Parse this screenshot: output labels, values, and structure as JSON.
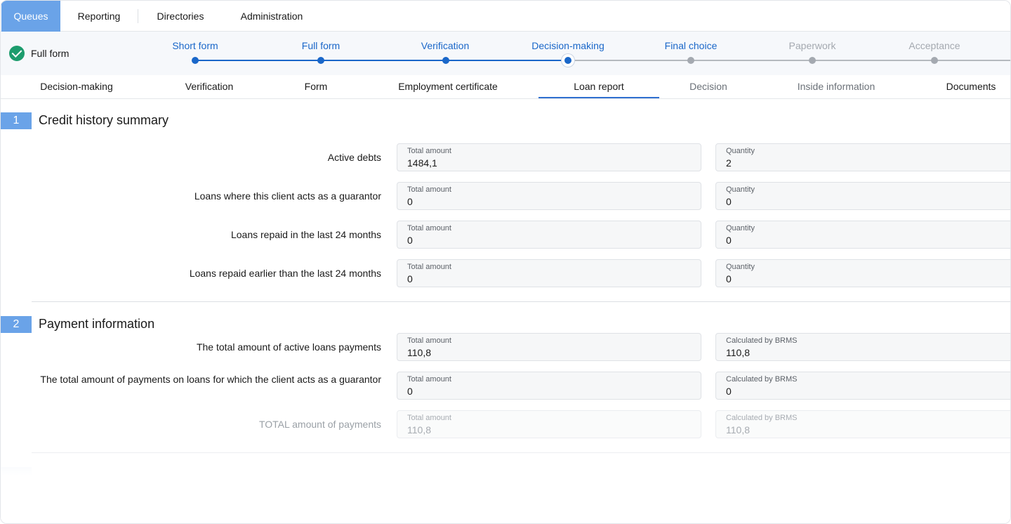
{
  "topnav": {
    "items": [
      "Queues",
      "Reporting",
      "Directories",
      "Administration"
    ],
    "active_color": "#6aa3e8"
  },
  "form_status": {
    "label": "Full form",
    "icon": "check-circle-icon",
    "color": "#1c9c6d"
  },
  "stepper": {
    "steps": [
      "Short form",
      "Full form",
      "Verification",
      "Decision-making",
      "Final choice",
      "Paperwork",
      "Acceptance"
    ],
    "current": "Decision-making",
    "done_color": "#1a67c9",
    "todo_color": "#a4a9b0"
  },
  "subtabs": {
    "items": [
      "Decision-making",
      "Verification",
      "Form",
      "Employment certificate",
      "Loan report",
      "Decision",
      "Inside information",
      "Documents"
    ],
    "active": "Loan report",
    "accent": "#2f6fcf"
  },
  "sections": [
    {
      "number": "1",
      "title": "Credit history summary",
      "rows": [
        {
          "label": "Active debts",
          "f1_caption": "Total amount",
          "f1_value": "1484,1",
          "f2_caption": "Quantity",
          "f2_value": "2"
        },
        {
          "label": "Loans where this client acts as a guarantor",
          "f1_caption": "Total amount",
          "f1_value": "0",
          "f2_caption": "Quantity",
          "f2_value": "0"
        },
        {
          "label": "Loans repaid in the last 24 months",
          "f1_caption": "Total amount",
          "f1_value": "0",
          "f2_caption": "Quantity",
          "f2_value": "0"
        },
        {
          "label": "Loans repaid earlier than the last 24 months",
          "f1_caption": "Total amount",
          "f1_value": "0",
          "f2_caption": "Quantity",
          "f2_value": "0"
        }
      ]
    },
    {
      "number": "2",
      "title": "Payment information",
      "rows": [
        {
          "label": "The total amount of active loans payments",
          "f1_caption": "Total amount",
          "f1_value": "110,8",
          "f2_caption": "Calculated by BRMS",
          "f2_value": "110,8"
        },
        {
          "label": "The total amount of payments on loans for which the client acts as a guarantor",
          "f1_caption": "Total amount",
          "f1_value": "0",
          "f2_caption": "Calculated by BRMS",
          "f2_value": "0"
        },
        {
          "label": "TOTAL amount of payments",
          "f1_caption": "Total amount",
          "f1_value": "110,8",
          "f2_caption": "Calculated by BRMS",
          "f2_value": "110,8"
        }
      ]
    }
  ]
}
